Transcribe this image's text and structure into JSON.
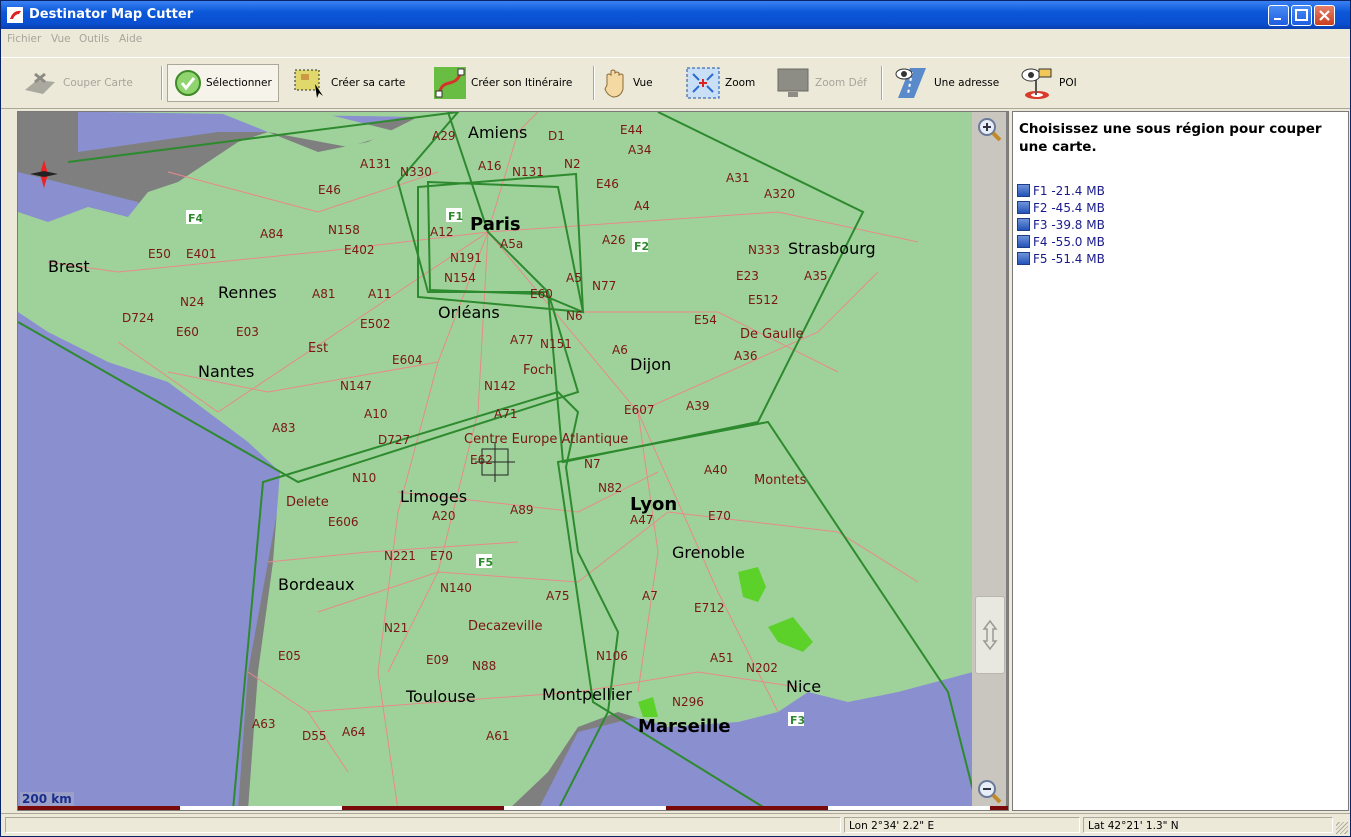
{
  "window": {
    "title": "Destinator Map Cutter"
  },
  "menu": {
    "items": [
      "Fichier",
      "Vue",
      "Outils",
      "Aide"
    ]
  },
  "toolbar": {
    "couper_carte": "Couper Carte",
    "selectionner": "Sélectionner",
    "creer_carte": "Créer sa carte",
    "creer_itineraire": "Créer son Itinéraire",
    "vue": "Vue",
    "zoom": "Zoom",
    "zoom_def": "Zoom Déf",
    "une_adresse": "Une adresse",
    "poi": "POI"
  },
  "map": {
    "scale": "200 km",
    "cities": {
      "amiens": "Amiens",
      "paris": "Paris",
      "brest": "Brest",
      "rennes": "Rennes",
      "orleans": "Orléans",
      "strasbourg": "Strasbourg",
      "nantes": "Nantes",
      "dijon": "Dijon",
      "degaulle": "De Gaulle",
      "centre": "Centre Europe Atlantique",
      "limoges": "Limoges",
      "lyon": "Lyon",
      "delete": "Delete",
      "montets": "Montets",
      "grenoble": "Grenoble",
      "bordeaux": "Bordeaux",
      "decazeville": "Decazeville",
      "toulouse": "Toulouse",
      "montpellier": "Montpellier",
      "marseille": "Marseille",
      "nice": "Nice",
      "est": "Est",
      "foch": "Foch"
    },
    "roads": [
      "A29",
      "D1",
      "E44",
      "A34",
      "A131",
      "N330",
      "A16",
      "N131",
      "N2",
      "E46",
      "A31",
      "A320",
      "E46",
      "F1",
      "A4",
      "N158",
      "A84",
      "A12",
      "E402",
      "A5a",
      "A26",
      "N333",
      "E50",
      "E401",
      "N191",
      "E23",
      "A35",
      "N154",
      "A5",
      "N77",
      "E512",
      "N24",
      "A81",
      "A11",
      "E60",
      "D724",
      "E60",
      "E03",
      "E502",
      "N6",
      "E54",
      "A77",
      "N151",
      "A6",
      "A36",
      "E604",
      "N147",
      "N142",
      "A10",
      "A71",
      "E607",
      "A39",
      "A83",
      "D727",
      "E62",
      "N10",
      "N7",
      "A40",
      "N82",
      "E606",
      "A20",
      "A89",
      "A47",
      "E70",
      "N221",
      "E70",
      "N140",
      "A75",
      "A7",
      "E712",
      "N21",
      "E05",
      "E09",
      "N88",
      "N106",
      "A51",
      "N202",
      "A63",
      "N296",
      "D55",
      "A64",
      "A61"
    ],
    "regions_on_map": [
      "F1",
      "F2",
      "F3",
      "F4",
      "F5"
    ]
  },
  "side": {
    "heading": "Choisissez une sous région pour couper une carte.",
    "regions": [
      "F1 -21.4 MB",
      "F2 -45.4 MB",
      "F3 -39.8 MB",
      "F4 -55.0 MB",
      "F5 -51.4 MB"
    ]
  },
  "status": {
    "lon": "Lon  2°34' 2.2\" E",
    "lat": "Lat 42°21' 1.3\" N"
  },
  "colors": {
    "land": "#9fd29b",
    "sea": "#8a8fcf",
    "road": "#e88a8a",
    "border": "#2e8a2e",
    "title": "#0b57d8"
  }
}
